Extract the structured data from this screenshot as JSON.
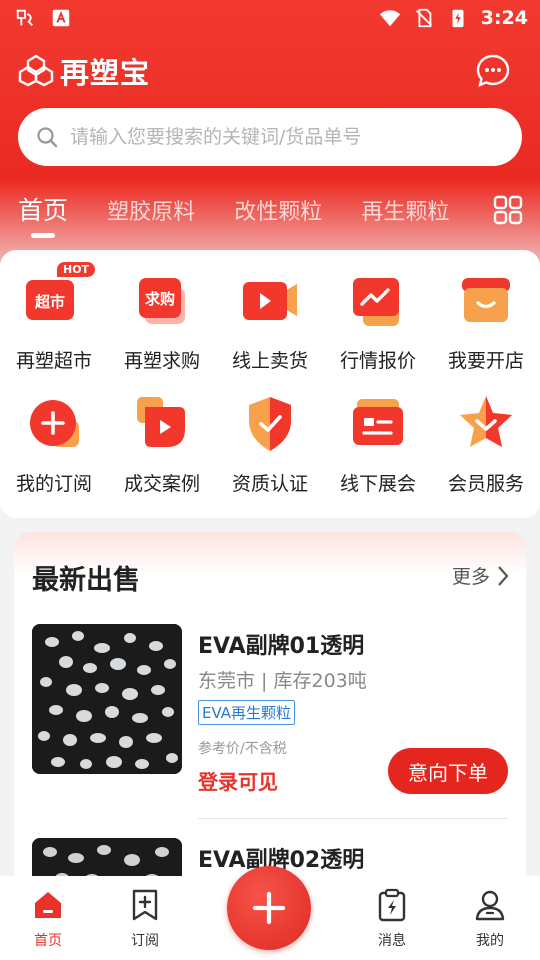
{
  "status_bar": {
    "time": "3:24"
  },
  "app": {
    "name": "再塑宝"
  },
  "search": {
    "placeholder": "请输入您要搜索的关键词/货品单号"
  },
  "tabs": [
    {
      "label": "首页"
    },
    {
      "label": "塑胶原料"
    },
    {
      "label": "改性颗粒"
    },
    {
      "label": "再生颗粒"
    }
  ],
  "categories": [
    {
      "label": "再塑超市",
      "icon": "supermarket-icon",
      "icon_text": "超市",
      "badge": "HOT"
    },
    {
      "label": "再塑求购",
      "icon": "purchase-icon",
      "icon_text": "求购"
    },
    {
      "label": "线上卖货",
      "icon": "video-sell-icon"
    },
    {
      "label": "行情报价",
      "icon": "market-trend-icon"
    },
    {
      "label": "我要开店",
      "icon": "shop-icon"
    },
    {
      "label": "我的订阅",
      "icon": "subscribe-icon"
    },
    {
      "label": "成交案例",
      "icon": "deal-case-icon"
    },
    {
      "label": "资质认证",
      "icon": "certification-shield-icon"
    },
    {
      "label": "线下展会",
      "icon": "exhibition-icon"
    },
    {
      "label": "会员服务",
      "icon": "member-star-icon"
    }
  ],
  "latest": {
    "title": "最新出售",
    "more_label": "更多",
    "items": [
      {
        "title": "EVA副牌01透明",
        "meta": "东莞市 | 库存203吨",
        "tag": "EVA再生颗粒",
        "ref": "参考价/不含税",
        "price": "登录可见",
        "action": "意向下单"
      },
      {
        "title": "EVA副牌02透明"
      }
    ]
  },
  "bottom_nav": [
    {
      "label": "首页",
      "icon": "home-icon",
      "active": true
    },
    {
      "label": "订阅",
      "icon": "bookmark-plus-icon"
    },
    {
      "label": "",
      "icon": "plus-icon"
    },
    {
      "label": "消息",
      "icon": "clipboard-bolt-icon"
    },
    {
      "label": "我的",
      "icon": "user-icon"
    }
  ],
  "colors": {
    "brand_red": "#ea2a22",
    "link_blue": "#2b78d4"
  }
}
